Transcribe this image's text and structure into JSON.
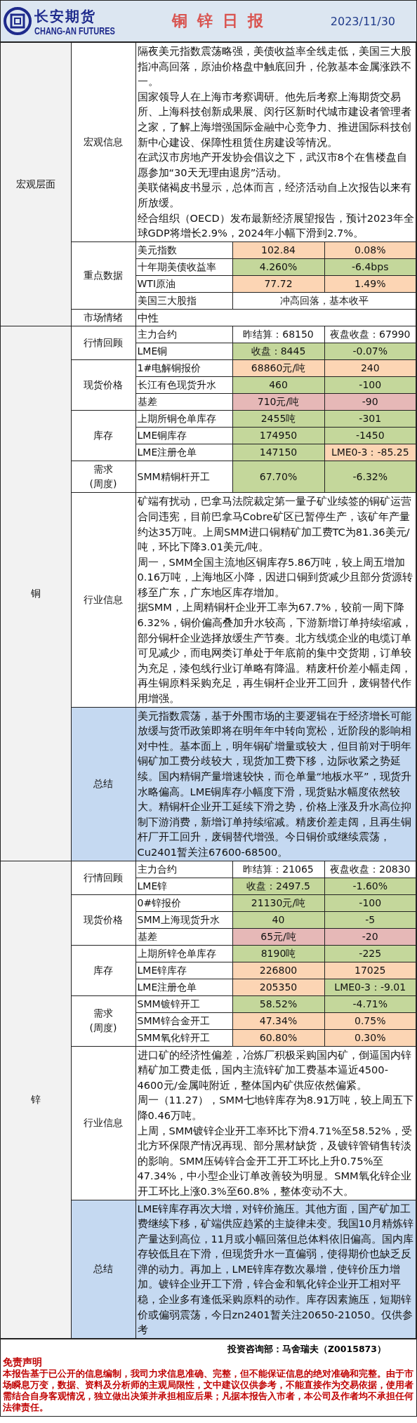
{
  "header": {
    "company_cn": "长安期货",
    "company_en": "CHANG-AN FUTURES",
    "title": "铜锌日报",
    "date": "2023/11/30"
  },
  "sections": [
    {
      "name": "宏观层面",
      "groups": [
        {
          "name": "宏观信息",
          "kind": "text",
          "paragraphs": [
            "隔夜美元指数震荡略强，美债收益率全线走低，美国三大股指冲高回落，原油价格盘中触底回升，伦敦基本金属涨跌不一。",
            "国家领导人在上海市考察调研。他先后考察上海期货交易所、上海科技创新成果展、闵行区新时代城市建设者管理者之家，了解上海增强国际金融中心竞争力、推进国际科技创新中心建设、保障性租赁住房建设等情况。",
            "在武汉市房地产开发协会倡议之下，武汉市8个在售楼盘自愿参加“30天无理由退房”活动。",
            "美联储褐皮书显示，总体而言，经济活动自上次报告以来有所放缓。",
            "经合组织（OECD）发布最新经济展望报告，预计2023年全球GDP将增长2.9%，2024年小幅下滑到2.7%。"
          ]
        },
        {
          "name": "重点数据",
          "kind": "table",
          "rows": [
            {
              "label": "美元指数",
              "cells": [
                {
                  "text": "102.84",
                  "color": "#fcd5b4"
                },
                {
                  "text": "0.08%",
                  "color": "#fcd5b4"
                }
              ]
            },
            {
              "label": "十年期美债收益率",
              "cells": [
                {
                  "text": "4.260%",
                  "color": "#c4d79b"
                },
                {
                  "text": "-6.4bps",
                  "color": "#c4d79b"
                }
              ]
            },
            {
              "label": "WTI原油",
              "cells": [
                {
                  "text": "77.72",
                  "color": "#fcd5b4"
                },
                {
                  "text": "1.49%",
                  "color": "#fcd5b4"
                }
              ]
            },
            {
              "label": "美国三大股指",
              "note": "冲高回落，基本收平"
            }
          ]
        },
        {
          "name": "市场情绪",
          "kind": "text",
          "paragraphs": [
            "中性"
          ]
        }
      ]
    },
    {
      "name": "铜",
      "groups": [
        {
          "name": "行情回顾",
          "kind": "table",
          "rows": [
            {
              "label": "主力合约",
              "cells": [
                {
                  "text": "昨结算：68150"
                },
                {
                  "text": "夜盘收盘：67990"
                }
              ]
            },
            {
              "label": "LME铜",
              "cells": [
                {
                  "text": "收盘：8445",
                  "color": "#c4d79b"
                },
                {
                  "text": "-0.07%",
                  "color": "#c4d79b"
                }
              ]
            }
          ]
        },
        {
          "name": "现货价格",
          "kind": "table",
          "rows": [
            {
              "label": "1#电解铜报价",
              "cells": [
                {
                  "text": "68860元/吨",
                  "color": "#fcd5b4"
                },
                {
                  "text": "240",
                  "color": "#fcd5b4"
                }
              ]
            },
            {
              "label": "长江有色现货升水",
              "cells": [
                {
                  "text": "460",
                  "color": "#c4d79b"
                },
                {
                  "text": "-100",
                  "color": "#c4d79b"
                }
              ]
            },
            {
              "label": "基差",
              "cells": [
                {
                  "text": "710元/吨",
                  "color": "#e6b8b7"
                },
                {
                  "text": "-90",
                  "color": "#e6b8b7"
                }
              ]
            }
          ]
        },
        {
          "name": "库存",
          "kind": "table",
          "rows": [
            {
              "label": "上期所铜仓单库存",
              "cells": [
                {
                  "text": "2455吨",
                  "color": "#c4d79b"
                },
                {
                  "text": "-301",
                  "color": "#c4d79b"
                }
              ]
            },
            {
              "label": "LME铜库存",
              "cells": [
                {
                  "text": "174950",
                  "color": "#c4d79b"
                },
                {
                  "text": "-1450",
                  "color": "#c4d79b"
                }
              ]
            },
            {
              "label": "LME注册仓单",
              "cells": [
                {
                  "text": "147150",
                  "color": "#c4d79b"
                },
                {
                  "text": "LME0-3：-85.25",
                  "color": "#fcd5b4"
                }
              ]
            }
          ]
        },
        {
          "name": "需求\n(周度)",
          "kind": "table",
          "rows": [
            {
              "label": "SMM精铜杆开工",
              "cells": [
                {
                  "text": "67.70%",
                  "color": "#c4d79b"
                },
                {
                  "text": "-6.32%",
                  "color": "#c4d79b"
                }
              ]
            }
          ]
        },
        {
          "name": "行业信息",
          "kind": "text",
          "paragraphs": [
            "矿端有扰动，巴拿马法院裁定第一量子矿业续签的铜矿运营合同违宪，目前巴拿马Cobre矿区已暂停生产，该矿年产量约达35万吨。上周SMM进口铜精矿加工费TC为81.36美元/吨，环比下降3.01美元/吨。",
            "周一，SMM全国主流地区铜库存5.86万吨，较上周五增加0.16万吨，上海地区小降，因进口铜到货减少且部分货源转移至广东，广东地区库存增加。",
            "据SMM，上周精铜杆企业开工率为67.7%，较前一周下降6.32%，铜价偏高叠加升水较高，下游新增订单持续缩减，部分铜杆企业选择放缓生产节奏。北方线缆企业的电缆订单可见减少，而电网类订单处于年底前的集中交货期，订单较为充足，漆包线行业订单略有降温。精废杆价差小幅走阔，再生铜原料采购充足，再生铜杆企业开工回升，废铜替代作用增强。"
          ]
        },
        {
          "name": "总结",
          "kind": "summary",
          "paragraphs": [
            "美元指数震荡，基于外围市场的主要逻辑在于经济增长可能放缓与货币政策即将在明年年中转向宽松，近阶段的影响相对中性。基本面上，明年铜矿增量或较大，但目前对于明年铜矿加工费分歧较大，现货加工费下移，边际收紧之势延续。国内精铜产量增速较快，而仓单量“地板水平”，现货升水略偏高。LME铜库存小幅度下滑，现货贴水幅度依然较大。精铜杆企业开工延续下滑之势，价格上涨及升水高位抑制下游消费，新增订单持续缩减。精废价差走阔，且再生铜杆厂开工回升，废铜替代增强。今日铜价或继续震荡，Cu2401暂关注67600-68500。"
          ]
        }
      ]
    },
    {
      "name": "锌",
      "groups": [
        {
          "name": "行情回顾",
          "kind": "table",
          "rows": [
            {
              "label": "主力合约",
              "cells": [
                {
                  "text": "昨结算：21065"
                },
                {
                  "text": "夜盘收盘：20830"
                }
              ]
            },
            {
              "label": "LME锌",
              "cells": [
                {
                  "text": "收盘：2497.5",
                  "color": "#c4d79b"
                },
                {
                  "text": "-1.60%",
                  "color": "#c4d79b"
                }
              ]
            }
          ]
        },
        {
          "name": "现货价格",
          "kind": "table",
          "rows": [
            {
              "label": "0#锌报价",
              "cells": [
                {
                  "text": "21130元/吨",
                  "color": "#c4d79b"
                },
                {
                  "text": "-100",
                  "color": "#c4d79b"
                }
              ]
            },
            {
              "label": "SMM上海现货升水",
              "cells": [
                {
                  "text": "40",
                  "color": "#c4d79b"
                },
                {
                  "text": "-5",
                  "color": "#c4d79b"
                }
              ]
            },
            {
              "label": "基差",
              "cells": [
                {
                  "text": "65元/吨",
                  "color": "#e6b8b7"
                },
                {
                  "text": "-20",
                  "color": "#e6b8b7"
                }
              ]
            }
          ]
        },
        {
          "name": "库存",
          "kind": "table",
          "rows": [
            {
              "label": "上期所锌仓单库存",
              "cells": [
                {
                  "text": "8190吨",
                  "color": "#c4d79b"
                },
                {
                  "text": "-225",
                  "color": "#c4d79b"
                }
              ]
            },
            {
              "label": "LME锌库存",
              "cells": [
                {
                  "text": "226800",
                  "color": "#fcd5b4"
                },
                {
                  "text": "17025",
                  "color": "#fcd5b4"
                }
              ]
            },
            {
              "label": "LME注册仓单",
              "cells": [
                {
                  "text": "205350",
                  "color": "#fcd5b4"
                },
                {
                  "text": "LME0-3：-9.01",
                  "color": "#c4d79b"
                }
              ]
            }
          ]
        },
        {
          "name": "需求\n(周度)",
          "kind": "table",
          "rows": [
            {
              "label": "SMM镀锌开工",
              "cells": [
                {
                  "text": "58.52%",
                  "color": "#c4d79b"
                },
                {
                  "text": "-4.71%",
                  "color": "#c4d79b"
                }
              ]
            },
            {
              "label": "SMM锌合金开工",
              "cells": [
                {
                  "text": "47.34%",
                  "color": "#fcd5b4"
                },
                {
                  "text": "0.75%",
                  "color": "#fcd5b4"
                }
              ]
            },
            {
              "label": "SMM氧化锌开工",
              "cells": [
                {
                  "text": "60.80%",
                  "color": "#fcd5b4"
                },
                {
                  "text": "0.30%",
                  "color": "#fcd5b4"
                }
              ]
            }
          ]
        },
        {
          "name": "行业信息",
          "kind": "text",
          "paragraphs": [
            "进口矿的经济性偏差，冶炼厂积极采购国内矿，倒逼国内锌精矿加工费走低，国内主流锌矿加工费基本逼近4500-4600元/金属吨附近，整体国内矿供应依然偏紧。",
            "周一（11.27），SMM七地锌库存为8.91万吨，较上周五下降0.46万吨。",
            "上周，SMM镀锌企业开工率环比下滑4.71%至58.52%，受北方环保限产情况再现、部分黑材缺货，及镀锌管销售转淡的影响。SMM压铸锌合金开工开工环比上升0.75%至47.34%，中小型企业订单改善较为明显。SMM氧化锌企业开工环比上涨0.3%至60.8%，整体变动不大。"
          ]
        },
        {
          "name": "总结",
          "kind": "summary",
          "paragraphs": [
            "LME锌库存再次大增，对锌价施压。其他方面，国产矿加工费继续下移，矿端供应趋紧的主旋律未变。我国10月精炼锌产量达到高位，11月或小幅回落但总体料依旧偏高。国内库存较低且在下滑，但现货升水一直偏弱，使得期价也缺乏反弹的动力。再加上，LME锌库存数次暴增，使锌价压力增加。镀锌企业开工下滑，锌合金和氧化锌企业开工相对平稳，企业多有逢低采购原料的动作。库存因素施压，短期锌价或偏弱震荡，今日zn2401暂关注20650-21050。仅供参考"
          ]
        }
      ]
    }
  ],
  "footer": {
    "author": "投资咨询部：马舍瑞夫（Z0015873）",
    "disclaimer_title": "免责声明",
    "disclaimer": "本报告基于已公开的信息编制，我司力求信息准确、完整，但不能保证信息的绝对准确和完整。由于市场瞬息万变，数据、资料及分析师的主观局限性，文中建议仅供参考，不能直接作为交易依据，使用者需结合自身客观情况，独立做出决策并承担相应后果；凡据本报告入市者，本公司及作者均不承担任何法律责任。"
  }
}
